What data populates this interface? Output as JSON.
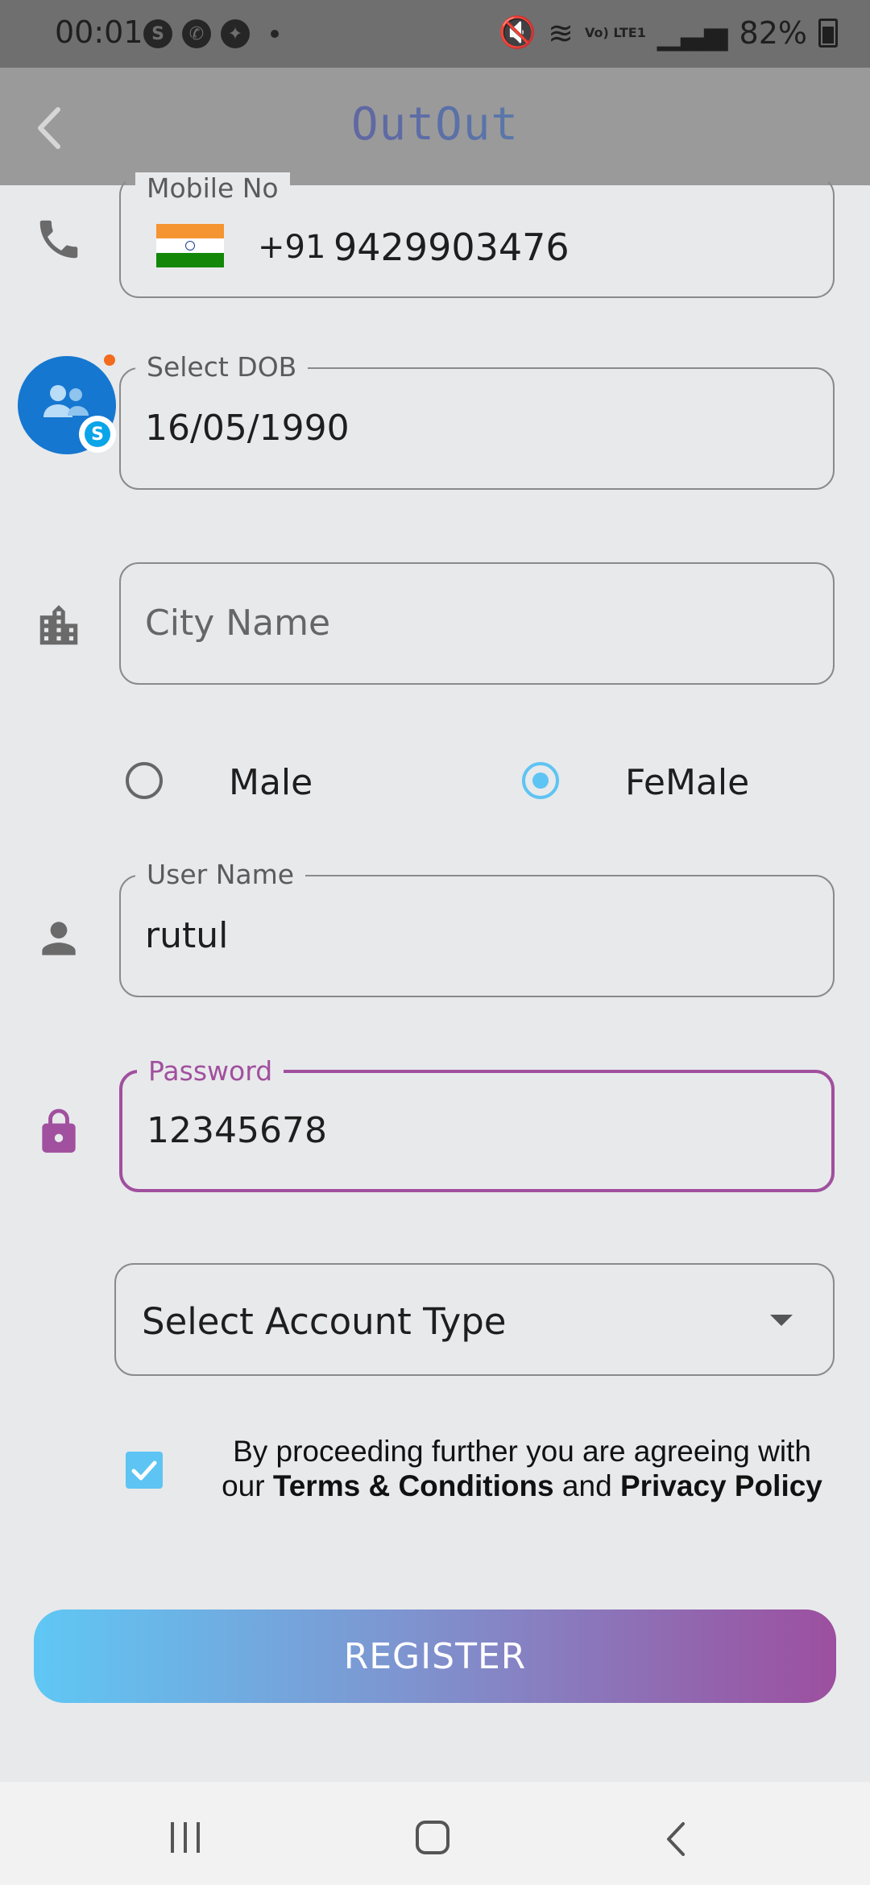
{
  "status_bar": {
    "time": "00:01",
    "signal_text": "Vo) LTE1",
    "battery": "82%"
  },
  "app_bar": {
    "title": "OutOut"
  },
  "form": {
    "mobile": {
      "label": "Mobile No",
      "country_code": "+91",
      "number": "9429903476"
    },
    "dob": {
      "label": "Select DOB",
      "value": "16/05/1990"
    },
    "city": {
      "placeholder": "City Name"
    },
    "gender": {
      "male_label": "Male",
      "female_label": "FeMale",
      "selected": "FeMale"
    },
    "username": {
      "label": "User Name",
      "value": "rutul"
    },
    "password": {
      "label": "Password",
      "value": "12345678"
    },
    "account_type": {
      "placeholder": "Select Account Type"
    },
    "terms": {
      "prefix": "By proceeding further you are agreeing with our",
      "terms_link": "Terms & Conditions",
      "joiner": "and",
      "privacy_link": "Privacy Policy",
      "checked": true
    },
    "register_label": "REGISTER"
  },
  "colors": {
    "accent_purple": "#a0509e",
    "accent_blue": "#5ec4f4",
    "bubble_blue": "#1577d0"
  },
  "icons": [
    "phone-icon",
    "calendar-icon",
    "city-icon",
    "person-icon",
    "lock-icon",
    "chevron-left-icon",
    "dropdown-arrow-icon"
  ]
}
